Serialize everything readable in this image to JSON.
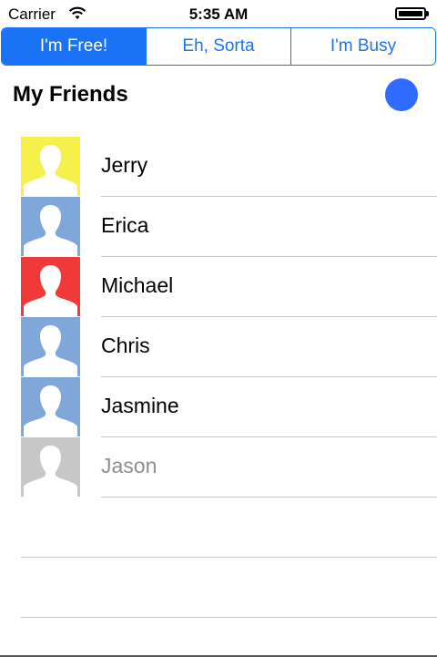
{
  "status_bar": {
    "carrier": "Carrier",
    "time": "5:35 AM",
    "wifi_icon": "wifi-icon",
    "battery_icon": "battery-icon"
  },
  "segmented": {
    "segments": [
      "I'm Free!",
      "Eh, Sorta",
      "I'm Busy"
    ],
    "selected_index": 0,
    "accent_color": "#1a73f5"
  },
  "header": {
    "title": "My Friends",
    "status_dot_color": "#2f6bff"
  },
  "friends": [
    {
      "name": "Jerry",
      "avatar_bg": "#f5f04c",
      "name_color": "#000000"
    },
    {
      "name": "Erica",
      "avatar_bg": "#7fa7d9",
      "name_color": "#000000"
    },
    {
      "name": "Michael",
      "avatar_bg": "#f03a3a",
      "name_color": "#000000"
    },
    {
      "name": "Chris",
      "avatar_bg": "#7fa7d9",
      "name_color": "#000000"
    },
    {
      "name": "Jasmine",
      "avatar_bg": "#7fa7d9",
      "name_color": "#000000"
    },
    {
      "name": "Jason",
      "avatar_bg": "#c7c7c7",
      "name_color": "#8e8e93"
    }
  ],
  "empty_rows": 2
}
